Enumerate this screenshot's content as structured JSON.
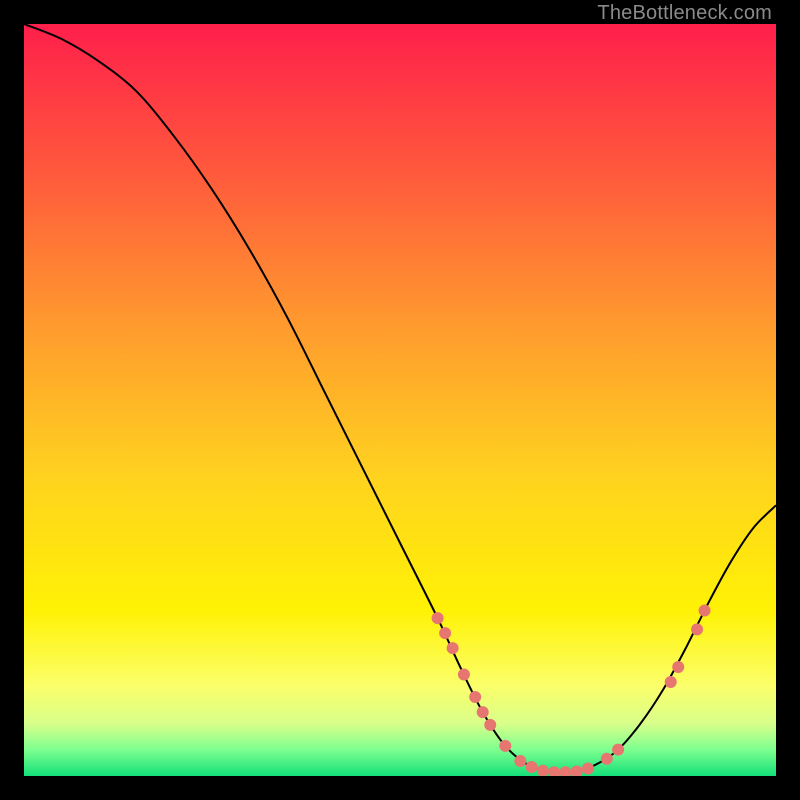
{
  "watermark": "TheBottleneck.com",
  "chart_data": {
    "type": "line",
    "title": "",
    "xlabel": "",
    "ylabel": "",
    "xlim": [
      0,
      100
    ],
    "ylim": [
      0,
      100
    ],
    "grid": false,
    "legend": false,
    "background_gradient": {
      "stops": [
        {
          "offset": 0.0,
          "color": "#ff1f4b"
        },
        {
          "offset": 0.2,
          "color": "#ff5a3c"
        },
        {
          "offset": 0.4,
          "color": "#ff9a2e"
        },
        {
          "offset": 0.6,
          "color": "#ffd21f"
        },
        {
          "offset": 0.78,
          "color": "#fff205"
        },
        {
          "offset": 0.88,
          "color": "#fbff6a"
        },
        {
          "offset": 0.93,
          "color": "#d9ff8a"
        },
        {
          "offset": 0.965,
          "color": "#7dff8f"
        },
        {
          "offset": 1.0,
          "color": "#14e07a"
        }
      ]
    },
    "series": [
      {
        "name": "curve",
        "color": "#000000",
        "width": 2,
        "points": [
          {
            "x": 0.0,
            "y": 100.0
          },
          {
            "x": 5.0,
            "y": 98.0
          },
          {
            "x": 10.0,
            "y": 95.0
          },
          {
            "x": 15.0,
            "y": 91.0
          },
          {
            "x": 20.0,
            "y": 85.0
          },
          {
            "x": 25.0,
            "y": 78.0
          },
          {
            "x": 30.0,
            "y": 70.0
          },
          {
            "x": 35.0,
            "y": 61.0
          },
          {
            "x": 40.0,
            "y": 51.0
          },
          {
            "x": 45.0,
            "y": 41.0
          },
          {
            "x": 50.0,
            "y": 31.0
          },
          {
            "x": 55.0,
            "y": 21.0
          },
          {
            "x": 58.0,
            "y": 14.5
          },
          {
            "x": 61.0,
            "y": 8.5
          },
          {
            "x": 64.0,
            "y": 4.0
          },
          {
            "x": 67.0,
            "y": 1.5
          },
          {
            "x": 70.0,
            "y": 0.5
          },
          {
            "x": 73.0,
            "y": 0.5
          },
          {
            "x": 76.0,
            "y": 1.5
          },
          {
            "x": 79.0,
            "y": 3.5
          },
          {
            "x": 82.0,
            "y": 7.0
          },
          {
            "x": 85.0,
            "y": 11.5
          },
          {
            "x": 88.0,
            "y": 17.0
          },
          {
            "x": 91.0,
            "y": 23.0
          },
          {
            "x": 94.0,
            "y": 28.5
          },
          {
            "x": 97.0,
            "y": 33.0
          },
          {
            "x": 100.0,
            "y": 36.0
          }
        ]
      }
    ],
    "markers": {
      "color": "#e77670",
      "radius": 6,
      "points": [
        {
          "x": 55.0,
          "y": 21.0
        },
        {
          "x": 56.0,
          "y": 19.0
        },
        {
          "x": 57.0,
          "y": 17.0
        },
        {
          "x": 58.5,
          "y": 13.5
        },
        {
          "x": 60.0,
          "y": 10.5
        },
        {
          "x": 61.0,
          "y": 8.5
        },
        {
          "x": 62.0,
          "y": 6.8
        },
        {
          "x": 64.0,
          "y": 4.0
        },
        {
          "x": 66.0,
          "y": 2.0
        },
        {
          "x": 67.5,
          "y": 1.2
        },
        {
          "x": 69.0,
          "y": 0.7
        },
        {
          "x": 70.5,
          "y": 0.5
        },
        {
          "x": 72.0,
          "y": 0.5
        },
        {
          "x": 73.5,
          "y": 0.6
        },
        {
          "x": 75.0,
          "y": 1.0
        },
        {
          "x": 77.5,
          "y": 2.3
        },
        {
          "x": 79.0,
          "y": 3.5
        },
        {
          "x": 86.0,
          "y": 12.5
        },
        {
          "x": 87.0,
          "y": 14.5
        },
        {
          "x": 89.5,
          "y": 19.5
        },
        {
          "x": 90.5,
          "y": 22.0
        }
      ]
    }
  }
}
